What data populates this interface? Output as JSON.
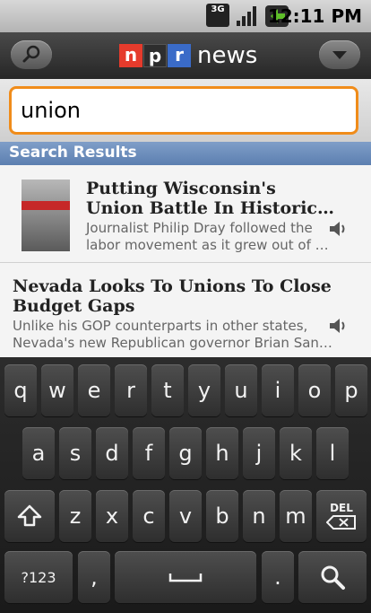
{
  "status_bar": {
    "network": "3G",
    "time": "12:11 PM"
  },
  "header": {
    "logo_letters": [
      "n",
      "p",
      "r"
    ],
    "logo_colors": [
      "#e53b2c",
      "#2e2e2e",
      "#3a6bc8"
    ],
    "title": "news",
    "search_icon": "search-icon",
    "menu_icon": "chevron-down-icon"
  },
  "search": {
    "value": "union"
  },
  "results": {
    "header": "Search Results",
    "items": [
      {
        "title_line1": "Putting Wisconsin's",
        "title_line2": "Union Battle In Historic…",
        "desc_line1": "Journalist Philip Dray followed the",
        "desc_line2": "labor movement as it grew out of …",
        "has_image": true,
        "icon": "speaker-icon"
      },
      {
        "title_line1": "Nevada Looks To Unions To Close",
        "title_line2": "Budget Gaps",
        "desc_line1": "Unlike his GOP counterparts in other states,",
        "desc_line2": "Nevada's new Republican governor Brian San…",
        "has_image": false,
        "icon": "speaker-icon"
      }
    ]
  },
  "keyboard": {
    "row1": [
      "q",
      "w",
      "e",
      "r",
      "t",
      "y",
      "u",
      "i",
      "o",
      "p"
    ],
    "row2": [
      "a",
      "s",
      "d",
      "f",
      "g",
      "h",
      "j",
      "k",
      "l"
    ],
    "row3": [
      "z",
      "x",
      "c",
      "v",
      "b",
      "n",
      "m"
    ],
    "del": "DEL",
    "sym": "?123",
    "comma": ",",
    "period": "."
  }
}
